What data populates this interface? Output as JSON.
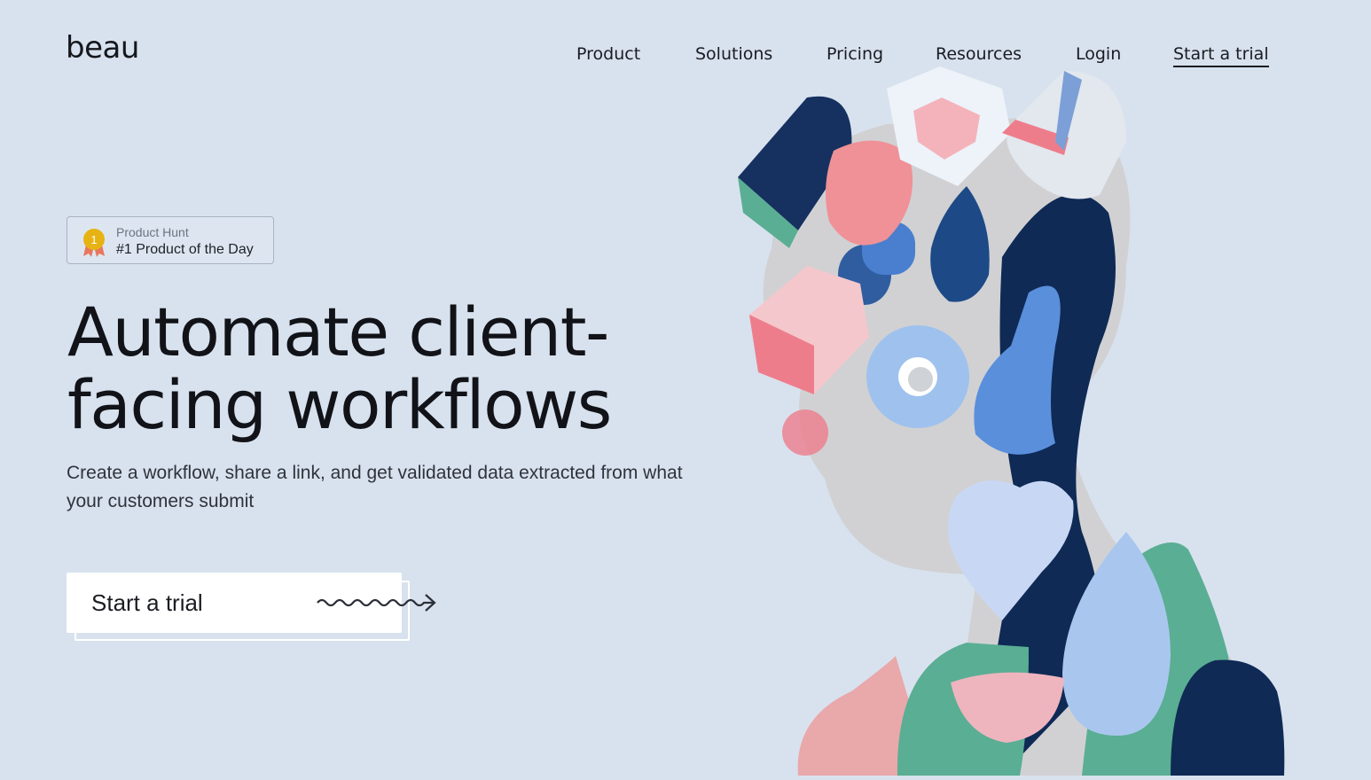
{
  "brand": {
    "logo": "beau"
  },
  "nav": {
    "items": [
      "Product",
      "Solutions",
      "Pricing",
      "Resources",
      "Login"
    ],
    "cta": "Start a trial"
  },
  "badge": {
    "rank": "1",
    "source": "Product Hunt",
    "title": "#1 Product of the Day"
  },
  "hero": {
    "headline": "Automate client-facing workflows",
    "subtitle": "Create a workflow, share a link, and get validated data extracted from what your customers submit",
    "cta": "Start a trial"
  },
  "colors": {
    "background": "#d8e2ee",
    "navy": "#0f2a55",
    "pink": "#ee7d8c",
    "green": "#5aae93",
    "blue": "#5a8fdc"
  },
  "icons": {
    "medal": "medal-icon",
    "arrow": "squiggle-arrow-icon"
  }
}
